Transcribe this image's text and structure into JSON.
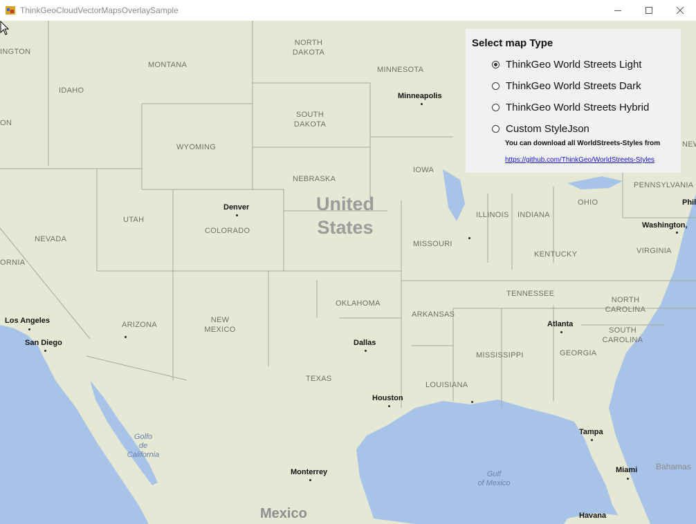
{
  "window": {
    "title": "ThinkGeoCloudVectorMapsOverlaySample",
    "controls": [
      "minimize",
      "maximize",
      "close"
    ]
  },
  "panel": {
    "title": "Select map Type",
    "options": [
      {
        "label": "ThinkGeo World Streets Light",
        "checked": true
      },
      {
        "label": "ThinkGeo World Streets Dark",
        "checked": false
      },
      {
        "label": "ThinkGeo World Streets Hybrid",
        "checked": false
      },
      {
        "label": "Custom StyleJson",
        "checked": false
      }
    ],
    "note": "You can download all WorldStreets-Styles from",
    "link": "https://github.com/ThinkGeo/WorldStreets-Styles"
  },
  "map": {
    "country_labels": {
      "us_line1": "United",
      "us_line2": "States",
      "mexico": "Mexico"
    },
    "state_labels": {
      "washington": "INGTON",
      "idaho": "IDAHO",
      "montana": "MONTANA",
      "oregon": "ON",
      "wyoming": "WYOMING",
      "north_dakota_1": "NORTH",
      "north_dakota_2": "DAKOTA",
      "south_dakota_1": "SOUTH",
      "south_dakota_2": "DAKOTA",
      "minnesota": "MINNESOTA",
      "nebraska": "NEBRASKA",
      "iowa": "IOWA",
      "utah": "UTAH",
      "nevada": "NEVADA",
      "colorado": "COLORADO",
      "california": "ORNIA",
      "illinois": "ILLINOIS",
      "indiana": "INDIANA",
      "ohio": "OHIO",
      "pennsylvania": "PENNSYLVANIA",
      "missouri": "MISSOURI",
      "kentucky": "KENTUCKY",
      "virginia": "VIRGINIA",
      "oklahoma": "OKLAHOMA",
      "tennessee": "TENNESSEE",
      "arkansas": "ARKANSAS",
      "arizona": "ARIZONA",
      "new_mexico_1": "NEW",
      "new_mexico_2": "MEXICO",
      "north_carolina_1": "NORTH",
      "north_carolina_2": "CAROLINA",
      "south_carolina_1": "SOUTH",
      "south_carolina_2": "CAROLINA",
      "mississippi": "MISSISSIPPI",
      "georgia": "GEORGIA",
      "texas": "TEXAS",
      "louisiana": "LOUISIANA",
      "new_york": "NEW"
    },
    "cities": {
      "minneapolis": "Minneapolis",
      "denver": "Denver",
      "washington_dc": "Washington,",
      "philadelphia": "Phil",
      "los_angeles": "Los Angeles",
      "san_diego": "San Diego",
      "dallas": "Dallas",
      "atlanta": "Atlanta",
      "houston": "Houston",
      "tampa": "Tampa",
      "miami": "Miami",
      "monterrey": "Monterrey",
      "havana": "Havana"
    },
    "water_labels": {
      "golfo_1": "Golfo",
      "golfo_2": "de",
      "golfo_3": "California",
      "gulf_1": "Gulf",
      "gulf_2": "of Mexico",
      "bahamas": "Bahamas"
    }
  }
}
